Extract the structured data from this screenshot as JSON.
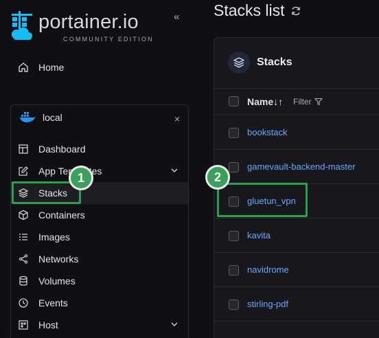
{
  "brand": {
    "name": "portainer.io",
    "edition": "COMMUNITY EDITION"
  },
  "sidebar": {
    "collapse_label": "«",
    "home_label": "Home",
    "environment": {
      "name": "local",
      "close_label": "×"
    },
    "items": [
      {
        "label": "Dashboard",
        "icon": "dashboard-icon"
      },
      {
        "label": "App Templates",
        "icon": "edit-icon",
        "chevron": true
      },
      {
        "label": "Stacks",
        "icon": "layers-icon",
        "active": true
      },
      {
        "label": "Containers",
        "icon": "box-icon"
      },
      {
        "label": "Images",
        "icon": "list-icon"
      },
      {
        "label": "Networks",
        "icon": "share-icon"
      },
      {
        "label": "Volumes",
        "icon": "database-icon"
      },
      {
        "label": "Events",
        "icon": "clock-icon"
      },
      {
        "label": "Host",
        "icon": "grid-icon",
        "chevron": true
      }
    ]
  },
  "main": {
    "page_title": "Stacks list",
    "panel_title": "Stacks",
    "columns": {
      "name": "Name",
      "sort_glyph": "↓↑",
      "filter": "Filter"
    },
    "rows": [
      "bookstack",
      "gamevault-backend-master",
      "gluetun_vpn",
      "kavita",
      "navidrome",
      "stirling-pdf"
    ]
  },
  "annotations": {
    "badge1": "1",
    "badge2": "2"
  },
  "colors": {
    "accent_green": "#23a34f",
    "link_blue": "#6aa6ff",
    "background": "#101014"
  }
}
